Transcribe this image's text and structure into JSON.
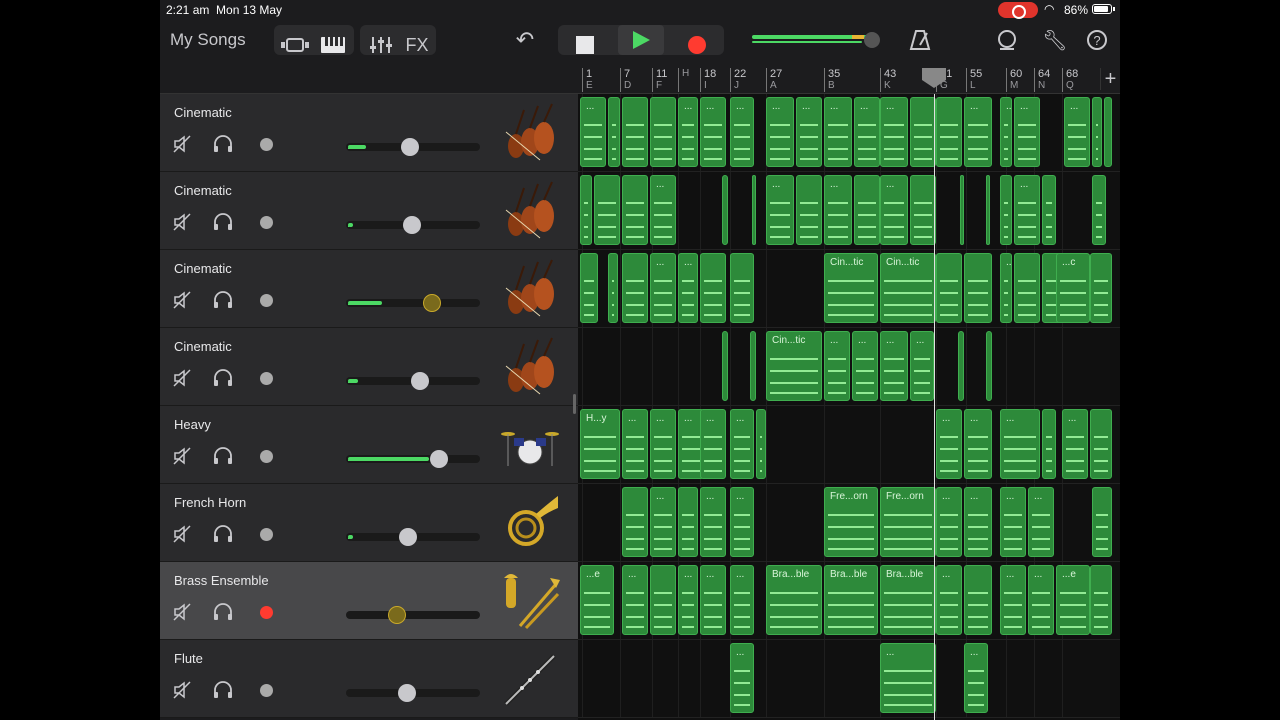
{
  "status_bar": {
    "time": "2:21 am",
    "date": "Mon 13 May",
    "battery": "86%"
  },
  "toolbar": {
    "my_songs": "My Songs",
    "fx_label": "FX",
    "icons": [
      "browser-icon",
      "keyboard-icon",
      "mixer-icon",
      "undo-icon",
      "stop-icon",
      "play-icon",
      "record-icon",
      "metronome-icon",
      "loop-icon",
      "wrench-icon",
      "help-icon"
    ]
  },
  "ruler": {
    "ticks": [
      {
        "bar": "1",
        "section": "E"
      },
      {
        "bar": "7",
        "section": "D"
      },
      {
        "bar": "11",
        "section": "F"
      },
      {
        "bar": "",
        "section": "H"
      },
      {
        "bar": "18",
        "section": "I"
      },
      {
        "bar": "22",
        "section": "J"
      },
      {
        "bar": "27",
        "section": "A"
      },
      {
        "bar": "35",
        "section": "B"
      },
      {
        "bar": "43",
        "section": "K"
      },
      {
        "bar": "51",
        "section": "G"
      },
      {
        "bar": "55",
        "section": "L"
      },
      {
        "bar": "60",
        "section": "M"
      },
      {
        "bar": "64",
        "section": "N"
      },
      {
        "bar": "68",
        "section": "Q"
      }
    ],
    "add_label": "+"
  },
  "tracks": [
    {
      "name": "Cinematic",
      "volume": 0.47,
      "level": 0.14,
      "armed": false,
      "instrument": "strings-icon",
      "selected": false
    },
    {
      "name": "Cinematic",
      "volume": 0.49,
      "level": 0.04,
      "armed": false,
      "instrument": "strings-icon",
      "selected": false
    },
    {
      "name": "Cinematic",
      "volume": 0.66,
      "level": 0.26,
      "armed": false,
      "instrument": "strings-icon",
      "selected": false
    },
    {
      "name": "Cinematic",
      "volume": 0.56,
      "level": 0.08,
      "armed": false,
      "instrument": "strings-icon",
      "selected": false
    },
    {
      "name": "Heavy",
      "volume": 0.72,
      "level": 0.62,
      "armed": false,
      "instrument": "drums-icon",
      "selected": false
    },
    {
      "name": "French Horn",
      "volume": 0.46,
      "level": 0.04,
      "armed": false,
      "instrument": "french-horn-icon",
      "selected": false
    },
    {
      "name": "Brass Ensemble",
      "volume": 0.36,
      "level": 0.0,
      "armed": true,
      "instrument": "brass-icon",
      "selected": true
    },
    {
      "name": "Flute",
      "volume": 0.45,
      "level": 0.0,
      "armed": false,
      "instrument": "flute-icon",
      "selected": false
    }
  ],
  "region_labels": {
    "r2a": "Cin...tic",
    "r2b": "Cin...tic",
    "r3a": "Cin...tic",
    "r4a": "H...y",
    "r5a": "Fre...orn",
    "r5b": "Fre...orn",
    "r6a": "Bra...ble",
    "r6b": "Bra...ble",
    "r6c": "Bra...ble",
    "r6d": "...e",
    "r6e": "...e",
    "r2c": "...c",
    "dots": "..."
  }
}
